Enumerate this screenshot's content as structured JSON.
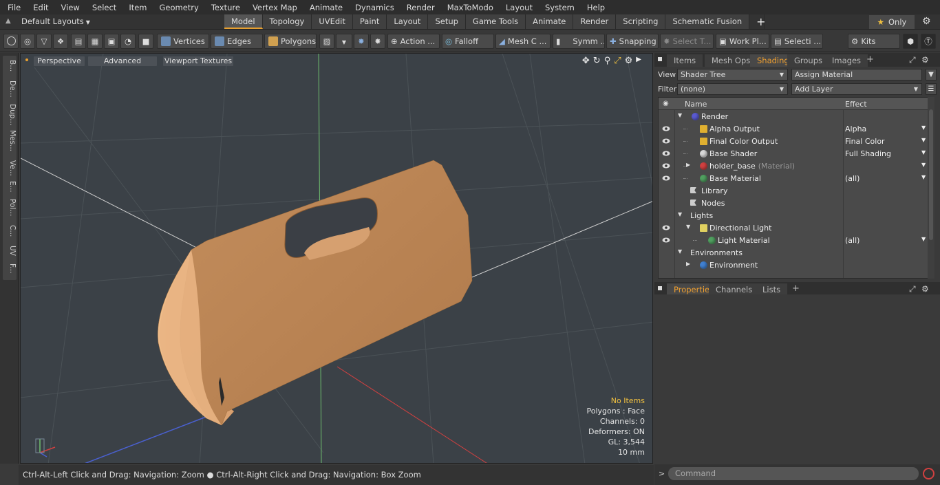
{
  "menu": [
    "File",
    "Edit",
    "View",
    "Select",
    "Item",
    "Geometry",
    "Texture",
    "Vertex Map",
    "Animate",
    "Dynamics",
    "Render",
    "MaxToModo",
    "Layout",
    "System",
    "Help"
  ],
  "layout": {
    "selector": "Default Layouts",
    "tabs": [
      "Model",
      "Topology",
      "UVEdit",
      "Paint",
      "Layout",
      "Setup",
      "Game Tools",
      "Animate",
      "Render",
      "Scripting",
      "Schematic Fusion"
    ],
    "active_tab": "Model",
    "only_label": "Only"
  },
  "toolbar": {
    "vertices": "Vertices",
    "edges": "Edges",
    "polygons": "Polygons",
    "action": "Action ...",
    "falloff": "Falloff",
    "mesh_c": "Mesh C ...",
    "symm": "Symm ...",
    "snapping": "Snapping",
    "select_t": "Select T...",
    "work_pl": "Work Pl...",
    "selecti": "Selecti ...",
    "kits": "Kits"
  },
  "left_tabs": [
    "B...",
    "De...",
    "Dup...",
    "Mes...",
    "Ve...",
    "E...",
    "Pol...",
    "C...",
    "UV",
    "F..."
  ],
  "viewport": {
    "view_label": "Perspective",
    "shading_label": "Advanced",
    "textures_label": "Viewport Textures",
    "info": {
      "items": "No Items",
      "polygons": "Polygons : Face",
      "channels": "Channels: 0",
      "deformers": "Deformers: ON",
      "gl": "GL: 3,544",
      "scale": "10 mm"
    }
  },
  "status": "Ctrl-Alt-Left Click and Drag: Navigation: Zoom ● Ctrl-Alt-Right Click and Drag: Navigation: Box Zoom",
  "right_panel": {
    "top_tabs": [
      "Items",
      "Mesh Ops",
      "Shading",
      "Groups",
      "Images"
    ],
    "active_top_tab": "Shading",
    "view_label": "View",
    "view_value": "Shader Tree",
    "assign_material": "Assign Material",
    "filter_label": "Filter",
    "filter_value": "(none)",
    "add_layer": "Add Layer",
    "col_name": "Name",
    "col_effect": "Effect",
    "rows": [
      {
        "name": "Render",
        "sub": "",
        "effect": "",
        "icon": "#5a5ad0"
      },
      {
        "name": "Alpha Output",
        "sub": "",
        "effect": "Alpha",
        "icon": "#e0b030"
      },
      {
        "name": "Final Color Output",
        "sub": "",
        "effect": "Final Color",
        "icon": "#e0b030"
      },
      {
        "name": "Base Shader",
        "sub": "",
        "effect": "Full Shading",
        "icon": "#d8d8d8"
      },
      {
        "name": "holder_base",
        "sub": "(Material)",
        "effect": "",
        "icon": "#d04040"
      },
      {
        "name": "Base Material",
        "sub": "",
        "effect": "(all)",
        "icon": "#50a060"
      },
      {
        "name": "Library",
        "sub": "",
        "effect": "",
        "icon": "#cccccc"
      },
      {
        "name": "Nodes",
        "sub": "",
        "effect": "",
        "icon": "#cccccc"
      },
      {
        "name": "Lights",
        "sub": "",
        "effect": "",
        "icon": ""
      },
      {
        "name": "Directional Light",
        "sub": "",
        "effect": "",
        "icon": "#e0d060"
      },
      {
        "name": "Light Material",
        "sub": "",
        "effect": "(all)",
        "icon": "#50a060"
      },
      {
        "name": "Environments",
        "sub": "",
        "effect": "",
        "icon": ""
      },
      {
        "name": "Environment",
        "sub": "",
        "effect": "",
        "icon": "#4080d0"
      }
    ],
    "bottom_tabs": [
      "Properties",
      "Channels",
      "Lists"
    ],
    "active_bottom_tab": "Properties",
    "command_placeholder": "Command"
  }
}
